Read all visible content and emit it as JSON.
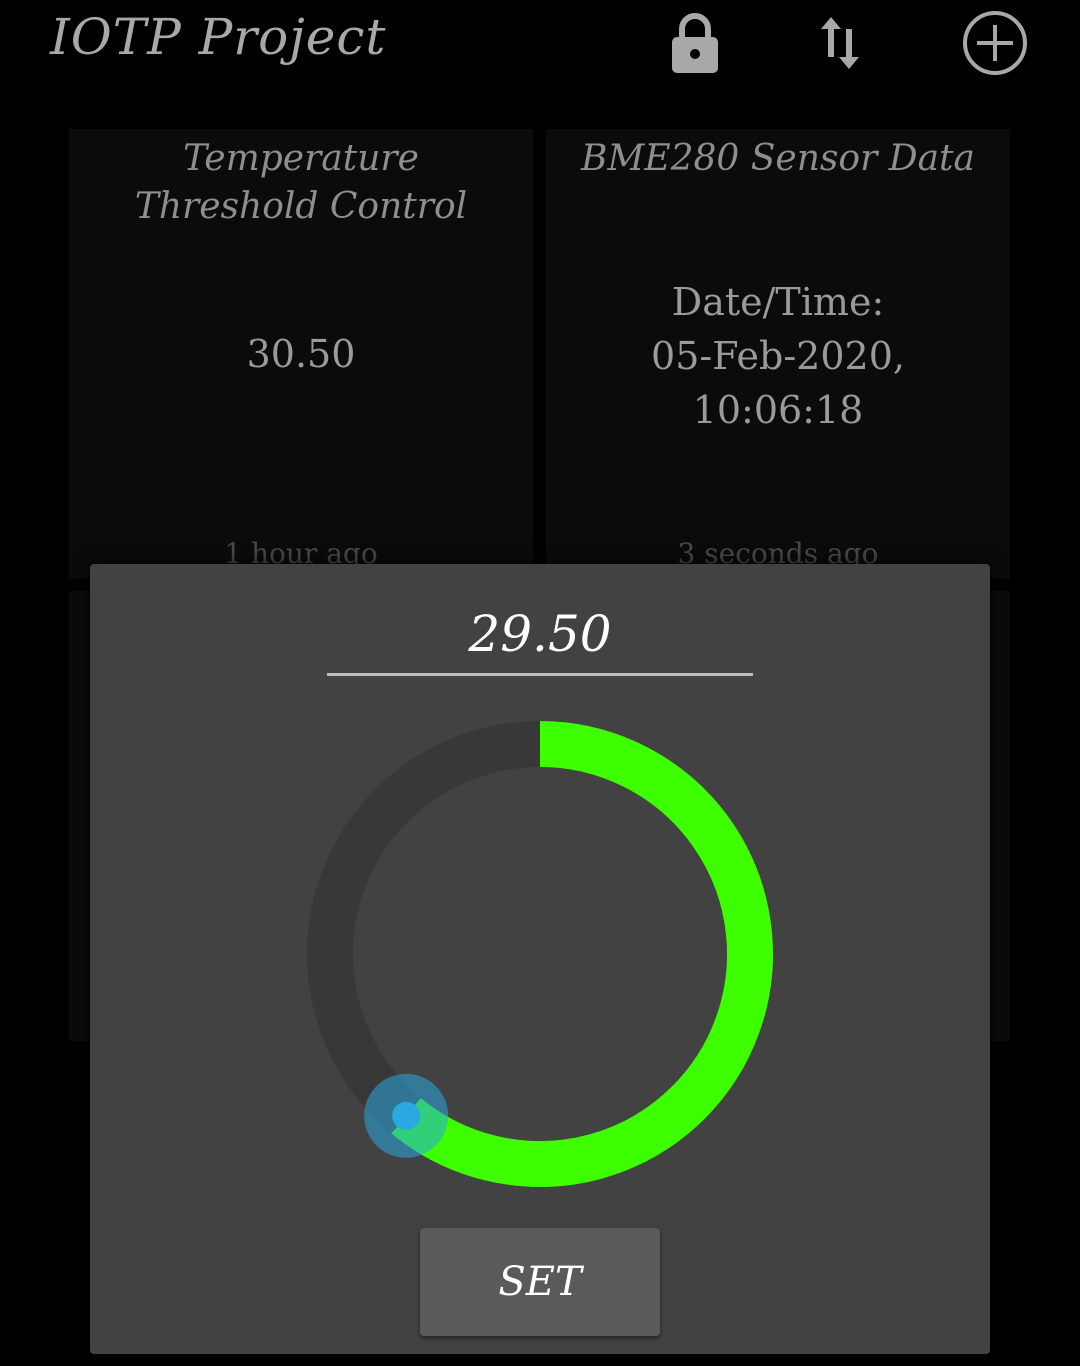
{
  "header": {
    "title": "IOTP Project",
    "icons": [
      "lock-icon",
      "sort-arrows-icon",
      "add-circle-icon"
    ]
  },
  "tiles": [
    {
      "title_line1": "Temperature",
      "title_line2": "Threshold Control",
      "value": "30.50",
      "footer": "1 hour ago"
    },
    {
      "title_line1": "BME280 Sensor Data",
      "value_line1": "Date/Time:",
      "value_line2": "05-Feb-2020,",
      "value_line3": "10:06:18",
      "footer": "3 seconds ago"
    }
  ],
  "dialog": {
    "value": "29.50",
    "knob_fraction": 0.61,
    "set_label": "SET"
  },
  "colors": {
    "arc_active": "#3dff00",
    "arc_track": "#383838",
    "thumb": "#2aa8e0",
    "dialog_bg": "#424242"
  }
}
